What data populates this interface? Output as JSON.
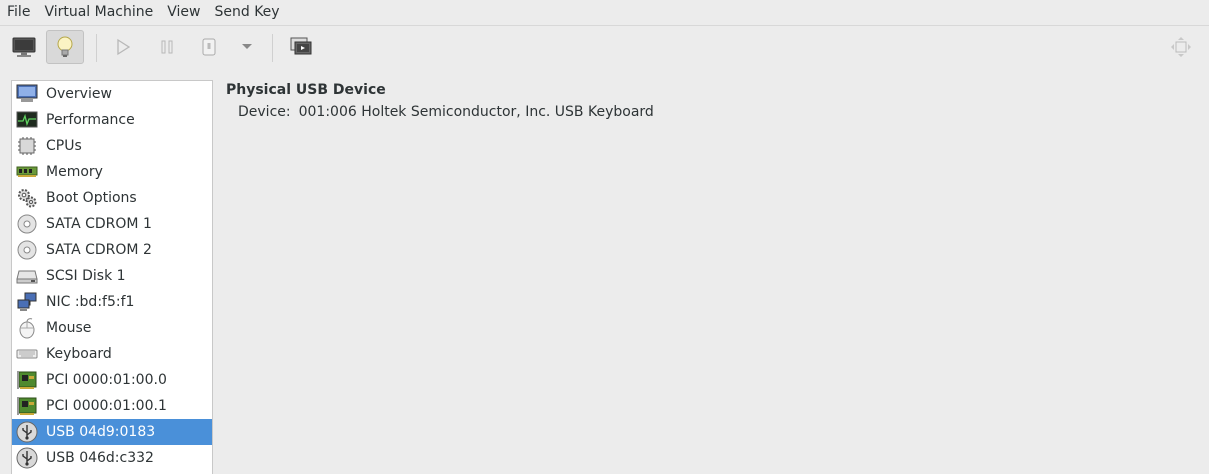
{
  "menubar": {
    "items": [
      "File",
      "Virtual Machine",
      "View",
      "Send Key"
    ]
  },
  "toolbar": {
    "buttons": [
      {
        "name": "console-button",
        "icon": "monitor-icon"
      },
      {
        "name": "details-button",
        "icon": "lightbulb-icon",
        "active": true
      },
      {
        "name": "run-button",
        "icon": "play-icon"
      },
      {
        "name": "pause-button",
        "icon": "pause-icon"
      },
      {
        "name": "shutdown-button",
        "icon": "power-icon"
      },
      {
        "name": "shutdown-menu-button",
        "icon": "chevron-down-icon"
      },
      {
        "name": "snapshots-button",
        "icon": "snapshots-icon"
      },
      {
        "name": "fullscreen-button",
        "icon": "fullscreen-icon"
      }
    ]
  },
  "sidebar": {
    "items": [
      {
        "label": "Overview",
        "icon": "monitor-icon"
      },
      {
        "label": "Performance",
        "icon": "performance-icon"
      },
      {
        "label": "CPUs",
        "icon": "cpu-icon"
      },
      {
        "label": "Memory",
        "icon": "memory-icon"
      },
      {
        "label": "Boot Options",
        "icon": "gears-icon"
      },
      {
        "label": "SATA CDROM 1",
        "icon": "cdrom-icon"
      },
      {
        "label": "SATA CDROM 2",
        "icon": "cdrom-icon"
      },
      {
        "label": "SCSI Disk 1",
        "icon": "disk-icon"
      },
      {
        "label": "NIC :bd:f5:f1",
        "icon": "network-icon"
      },
      {
        "label": "Mouse",
        "icon": "mouse-icon"
      },
      {
        "label": "Keyboard",
        "icon": "keyboard-icon"
      },
      {
        "label": "PCI 0000:01:00.0",
        "icon": "pci-card-icon"
      },
      {
        "label": "PCI 0000:01:00.1",
        "icon": "pci-card-icon"
      },
      {
        "label": "USB 04d9:0183",
        "icon": "usb-icon",
        "selected": true
      },
      {
        "label": "USB 046d:c332",
        "icon": "usb-icon"
      }
    ],
    "selected_color": "#4a90d9"
  },
  "details": {
    "title": "Physical USB Device",
    "device_label": "Device:",
    "device_value": "001:006 Holtek Semiconductor, Inc. USB Keyboard"
  }
}
